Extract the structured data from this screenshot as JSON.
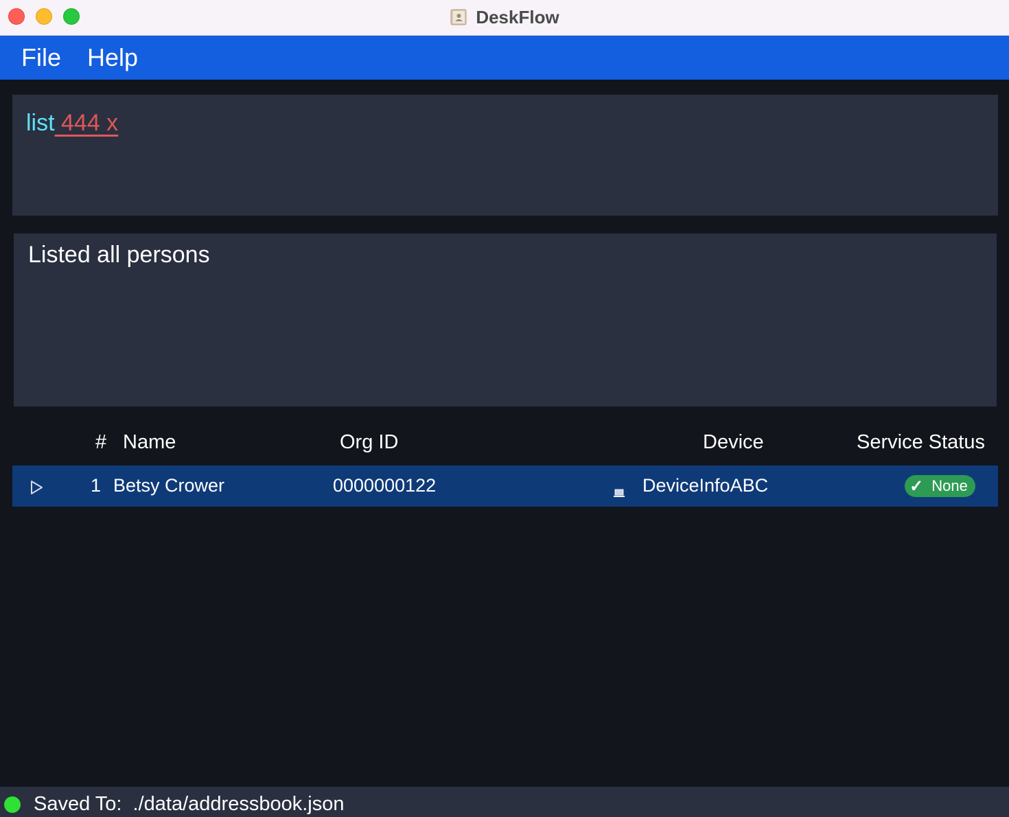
{
  "window": {
    "title": "DeskFlow",
    "app_icon": "contacts-book-icon"
  },
  "menu": {
    "items": [
      {
        "label": "File"
      },
      {
        "label": "Help"
      }
    ]
  },
  "command_box": {
    "command": "list",
    "error_args": " 444 x"
  },
  "result_box": {
    "message": "Listed all persons"
  },
  "table": {
    "columns": {
      "index": "#",
      "name": "Name",
      "org_id": "Org ID",
      "device": "Device",
      "service_status": "Service Status"
    },
    "rows": [
      {
        "index": "1",
        "name": "Betsy Crower",
        "org_id": "0000000122",
        "device_icon": "laptop-icon",
        "device": "DeviceInfoABC",
        "service_status": "None",
        "status_icon": "check-icon",
        "status_color": "#2e9b54",
        "selected": true
      }
    ]
  },
  "statusbar": {
    "label": "Saved To:  ./data/addressbook.json",
    "indicator_color": "#2fe035"
  },
  "colors": {
    "menubar": "#145ee0",
    "background": "#12151c",
    "panel": "#2a3040",
    "selected_row": "#0f3a78",
    "command_keyword": "#5ee1f5",
    "command_error": "#e05757"
  }
}
